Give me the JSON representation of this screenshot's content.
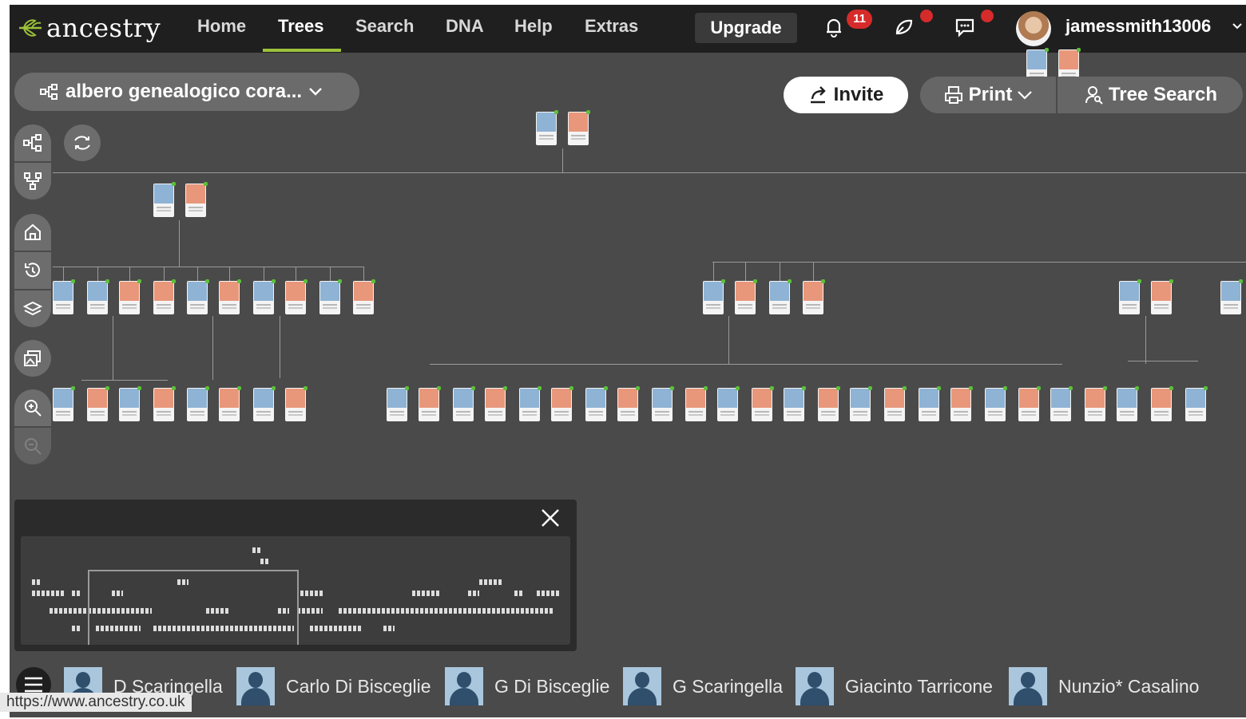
{
  "brand": {
    "logo_text": "ancestry"
  },
  "nav": {
    "items": [
      {
        "label": "Home",
        "active": false
      },
      {
        "label": "Trees",
        "active": true
      },
      {
        "label": "Search",
        "active": false
      },
      {
        "label": "DNA",
        "active": false
      },
      {
        "label": "Help",
        "active": false
      },
      {
        "label": "Extras",
        "active": false
      }
    ],
    "upgrade_label": "Upgrade",
    "notifications_count": "11",
    "username": "jamessmith13006"
  },
  "tree": {
    "title": "albero genealogico cora...",
    "invite_label": "Invite",
    "print_label": "Print",
    "tree_search_label": "Tree Search"
  },
  "tools": [
    "tree-view-icon",
    "compare-icon",
    "pedigree-icon",
    "home-icon",
    "history-icon",
    "layers-icon",
    "gallery-icon",
    "zoom-in-icon",
    "zoom-out-icon"
  ],
  "people_bar": [
    {
      "name": "D Scaringella"
    },
    {
      "name": "Carlo Di Bisceglie"
    },
    {
      "name": "G Di Bisceglie"
    },
    {
      "name": "G Scaringella"
    },
    {
      "name": "Giacinto Tarricone"
    },
    {
      "name": "Nunzio* Casalino"
    }
  ],
  "status_url": "https://www.ancestry.co.uk",
  "colors": {
    "nav_bg": "#1f1f1f",
    "canvas_bg": "#4a4a4a",
    "accent": "#9cc13b",
    "alert": "#d62b2b",
    "male": "#8fb3d4",
    "female": "#e8977b"
  }
}
